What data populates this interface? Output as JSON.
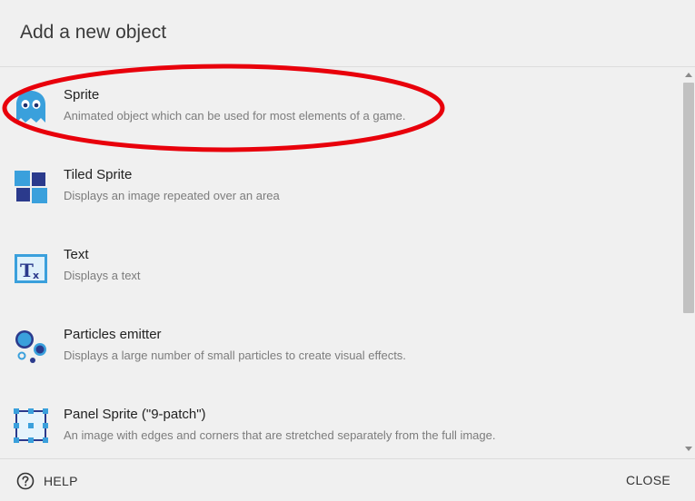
{
  "dialog": {
    "title": "Add a new object"
  },
  "items": [
    {
      "icon": "ghost-sprite-icon",
      "title": "Sprite",
      "description": "Animated object which can be used for most elements of a game."
    },
    {
      "icon": "tiled-sprite-icon",
      "title": "Tiled Sprite",
      "description": "Displays an image repeated over an area"
    },
    {
      "icon": "text-object-icon",
      "title": "Text",
      "description": "Displays a text"
    },
    {
      "icon": "particles-emitter-icon",
      "title": "Particles emitter",
      "description": "Displays a large number of small particles to create visual effects."
    },
    {
      "icon": "panel-sprite-icon",
      "title": "Panel Sprite (\"9-patch\")",
      "description": "An image with edges and corners that are stretched separately from the full image."
    }
  ],
  "footer": {
    "help_label": "HELP",
    "close_label": "CLOSE"
  },
  "colors": {
    "background": "#f0f0f0",
    "annotation_red": "#e8000b",
    "icon_blue": "#3aa0dc",
    "icon_dark_blue": "#2b3a8c"
  }
}
